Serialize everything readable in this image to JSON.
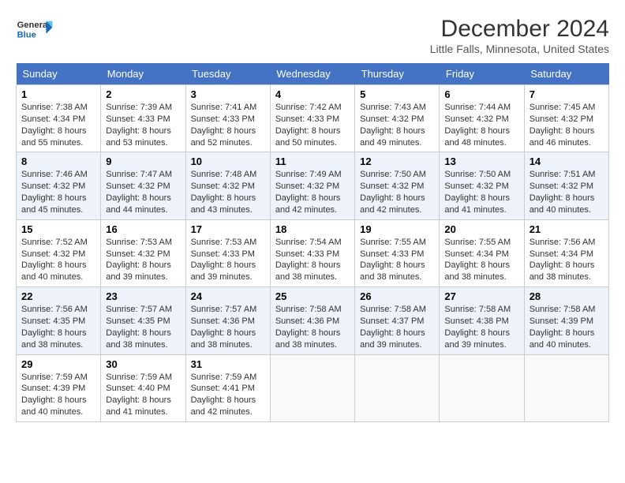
{
  "header": {
    "logo_general": "General",
    "logo_blue": "Blue",
    "month": "December 2024",
    "location": "Little Falls, Minnesota, United States"
  },
  "weekdays": [
    "Sunday",
    "Monday",
    "Tuesday",
    "Wednesday",
    "Thursday",
    "Friday",
    "Saturday"
  ],
  "weeks": [
    [
      {
        "day": "1",
        "sunrise": "7:38 AM",
        "sunset": "4:34 PM",
        "daylight": "8 hours and 55 minutes."
      },
      {
        "day": "2",
        "sunrise": "7:39 AM",
        "sunset": "4:33 PM",
        "daylight": "8 hours and 53 minutes."
      },
      {
        "day": "3",
        "sunrise": "7:41 AM",
        "sunset": "4:33 PM",
        "daylight": "8 hours and 52 minutes."
      },
      {
        "day": "4",
        "sunrise": "7:42 AM",
        "sunset": "4:33 PM",
        "daylight": "8 hours and 50 minutes."
      },
      {
        "day": "5",
        "sunrise": "7:43 AM",
        "sunset": "4:32 PM",
        "daylight": "8 hours and 49 minutes."
      },
      {
        "day": "6",
        "sunrise": "7:44 AM",
        "sunset": "4:32 PM",
        "daylight": "8 hours and 48 minutes."
      },
      {
        "day": "7",
        "sunrise": "7:45 AM",
        "sunset": "4:32 PM",
        "daylight": "8 hours and 46 minutes."
      }
    ],
    [
      {
        "day": "8",
        "sunrise": "7:46 AM",
        "sunset": "4:32 PM",
        "daylight": "8 hours and 45 minutes."
      },
      {
        "day": "9",
        "sunrise": "7:47 AM",
        "sunset": "4:32 PM",
        "daylight": "8 hours and 44 minutes."
      },
      {
        "day": "10",
        "sunrise": "7:48 AM",
        "sunset": "4:32 PM",
        "daylight": "8 hours and 43 minutes."
      },
      {
        "day": "11",
        "sunrise": "7:49 AM",
        "sunset": "4:32 PM",
        "daylight": "8 hours and 42 minutes."
      },
      {
        "day": "12",
        "sunrise": "7:50 AM",
        "sunset": "4:32 PM",
        "daylight": "8 hours and 42 minutes."
      },
      {
        "day": "13",
        "sunrise": "7:50 AM",
        "sunset": "4:32 PM",
        "daylight": "8 hours and 41 minutes."
      },
      {
        "day": "14",
        "sunrise": "7:51 AM",
        "sunset": "4:32 PM",
        "daylight": "8 hours and 40 minutes."
      }
    ],
    [
      {
        "day": "15",
        "sunrise": "7:52 AM",
        "sunset": "4:32 PM",
        "daylight": "8 hours and 40 minutes."
      },
      {
        "day": "16",
        "sunrise": "7:53 AM",
        "sunset": "4:32 PM",
        "daylight": "8 hours and 39 minutes."
      },
      {
        "day": "17",
        "sunrise": "7:53 AM",
        "sunset": "4:33 PM",
        "daylight": "8 hours and 39 minutes."
      },
      {
        "day": "18",
        "sunrise": "7:54 AM",
        "sunset": "4:33 PM",
        "daylight": "8 hours and 38 minutes."
      },
      {
        "day": "19",
        "sunrise": "7:55 AM",
        "sunset": "4:33 PM",
        "daylight": "8 hours and 38 minutes."
      },
      {
        "day": "20",
        "sunrise": "7:55 AM",
        "sunset": "4:34 PM",
        "daylight": "8 hours and 38 minutes."
      },
      {
        "day": "21",
        "sunrise": "7:56 AM",
        "sunset": "4:34 PM",
        "daylight": "8 hours and 38 minutes."
      }
    ],
    [
      {
        "day": "22",
        "sunrise": "7:56 AM",
        "sunset": "4:35 PM",
        "daylight": "8 hours and 38 minutes."
      },
      {
        "day": "23",
        "sunrise": "7:57 AM",
        "sunset": "4:35 PM",
        "daylight": "8 hours and 38 minutes."
      },
      {
        "day": "24",
        "sunrise": "7:57 AM",
        "sunset": "4:36 PM",
        "daylight": "8 hours and 38 minutes."
      },
      {
        "day": "25",
        "sunrise": "7:58 AM",
        "sunset": "4:36 PM",
        "daylight": "8 hours and 38 minutes."
      },
      {
        "day": "26",
        "sunrise": "7:58 AM",
        "sunset": "4:37 PM",
        "daylight": "8 hours and 39 minutes."
      },
      {
        "day": "27",
        "sunrise": "7:58 AM",
        "sunset": "4:38 PM",
        "daylight": "8 hours and 39 minutes."
      },
      {
        "day": "28",
        "sunrise": "7:58 AM",
        "sunset": "4:39 PM",
        "daylight": "8 hours and 40 minutes."
      }
    ],
    [
      {
        "day": "29",
        "sunrise": "7:59 AM",
        "sunset": "4:39 PM",
        "daylight": "8 hours and 40 minutes."
      },
      {
        "day": "30",
        "sunrise": "7:59 AM",
        "sunset": "4:40 PM",
        "daylight": "8 hours and 41 minutes."
      },
      {
        "day": "31",
        "sunrise": "7:59 AM",
        "sunset": "4:41 PM",
        "daylight": "8 hours and 42 minutes."
      },
      null,
      null,
      null,
      null
    ]
  ],
  "labels": {
    "sunrise": "Sunrise:",
    "sunset": "Sunset:",
    "daylight": "Daylight:"
  }
}
